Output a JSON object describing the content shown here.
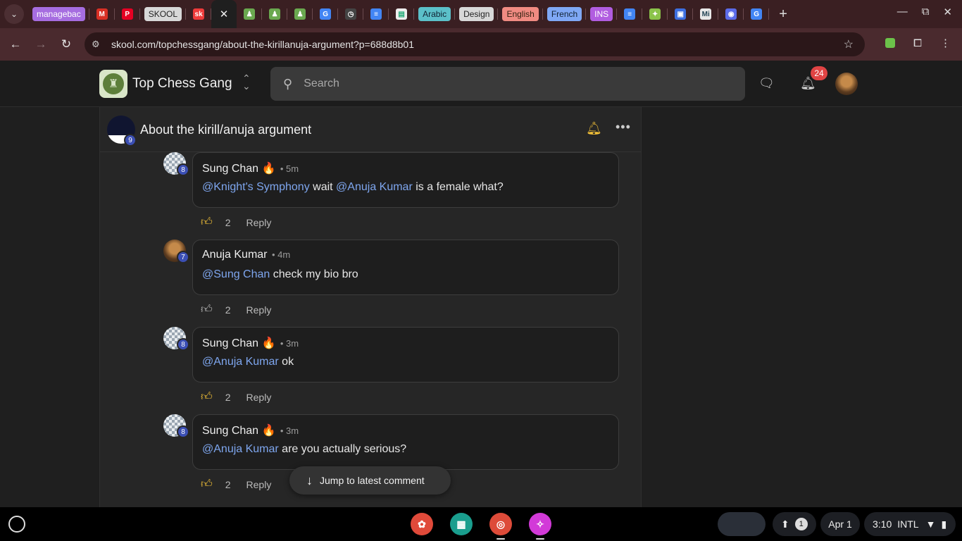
{
  "browser": {
    "tabs": [
      {
        "type": "chip",
        "label": "managebac",
        "color": "#a66de0",
        "icon": "managebac-label"
      },
      {
        "type": "icon",
        "icon": "gmail-icon",
        "glyph": "M",
        "color": "#d93025"
      },
      {
        "type": "icon",
        "icon": "pinterest-icon",
        "glyph": "P",
        "color": "#e60023"
      },
      {
        "type": "chip",
        "label": "SKOOL",
        "color": "#d8d8d8",
        "text_color": "#222",
        "icon": "skool-label"
      },
      {
        "type": "icon",
        "icon": "skool-icon",
        "glyph": "sk",
        "color": "#ef3b3b"
      },
      {
        "type": "active",
        "icon": "close-icon",
        "glyph": "✕"
      },
      {
        "type": "icon",
        "icon": "chess-pawn-icon",
        "glyph": "♟",
        "color": "#6aa84f"
      },
      {
        "type": "icon",
        "icon": "chess-pawn-icon",
        "glyph": "♟",
        "color": "#6aa84f"
      },
      {
        "type": "icon",
        "icon": "chess-pawn-icon",
        "glyph": "♟",
        "color": "#6aa84f"
      },
      {
        "type": "icon",
        "icon": "google-icon",
        "glyph": "G",
        "color": "#4285f4"
      },
      {
        "type": "icon",
        "icon": "clock-app-icon",
        "glyph": "◷",
        "color": "#444"
      },
      {
        "type": "icon",
        "icon": "google-docs-icon",
        "glyph": "≡",
        "color": "#4285f4"
      },
      {
        "type": "icon",
        "icon": "chart-page-icon",
        "glyph": "▤",
        "color": "#eee",
        "text_color": "#2a7"
      },
      {
        "type": "chip",
        "label": "Arabic",
        "color": "#5bc0c9",
        "text_color": "#123",
        "icon": "arabic-label"
      },
      {
        "type": "chip",
        "label": "Design",
        "color": "#d8d8d8",
        "text_color": "#222",
        "icon": "design-label"
      },
      {
        "type": "chip",
        "label": "English",
        "color": "#f08b82",
        "text_color": "#321",
        "icon": "english-label"
      },
      {
        "type": "chip",
        "label": "French",
        "color": "#7fa8f5",
        "text_color": "#123",
        "icon": "french-label"
      },
      {
        "type": "chip",
        "label": "INS",
        "color": "#b15de0",
        "icon": "ins-label"
      },
      {
        "type": "icon",
        "icon": "google-docs-icon",
        "glyph": "≡",
        "color": "#4285f4"
      },
      {
        "type": "icon",
        "icon": "alien-icon",
        "glyph": "✦",
        "color": "#8bc34a"
      },
      {
        "type": "icon",
        "icon": "phone-app-icon",
        "glyph": "▣",
        "color": "#3d6fe0"
      },
      {
        "type": "icon",
        "icon": "mi-icon",
        "glyph": "Mi",
        "color": "#e8e8e8",
        "text_color": "#245"
      },
      {
        "type": "icon",
        "icon": "chat-app-icon",
        "glyph": "◉",
        "color": "#5b6be8"
      },
      {
        "type": "icon",
        "icon": "google-icon",
        "glyph": "G",
        "color": "#4285f4"
      }
    ],
    "url": "skool.com/topchessgang/about-the-kirillanuja-argument?p=688d8b01"
  },
  "header": {
    "group_name": "Top Chess Gang",
    "search_placeholder": "Search",
    "notification_count": "24"
  },
  "post": {
    "title": "About the kirill/anuja argument",
    "author_level": "9"
  },
  "comments": [
    {
      "author": "Sung Chan 🔥",
      "time": "• 5m",
      "level": "8",
      "avatar": "chess",
      "segments": [
        {
          "text": "@Knight's Symphony",
          "mention": true
        },
        {
          "text": " wait ",
          "mention": false
        },
        {
          "text": "@Anuja Kumar",
          "mention": true
        },
        {
          "text": " is a female what?",
          "mention": false
        }
      ],
      "likes": "2",
      "liked": true,
      "reply_label": "Reply"
    },
    {
      "author": "Anuja Kumar",
      "time": "• 4m",
      "level": "7",
      "avatar": "mona",
      "segments": [
        {
          "text": "@Sung Chan",
          "mention": true
        },
        {
          "text": " check my bio bro",
          "mention": false
        }
      ],
      "likes": "2",
      "liked": false,
      "reply_label": "Reply"
    },
    {
      "author": "Sung Chan 🔥",
      "time": "• 3m",
      "level": "8",
      "avatar": "chess",
      "segments": [
        {
          "text": "@Anuja Kumar",
          "mention": true
        },
        {
          "text": " ok",
          "mention": false
        }
      ],
      "likes": "2",
      "liked": true,
      "reply_label": "Reply"
    },
    {
      "author": "Sung Chan 🔥",
      "time": "• 3m",
      "level": "8",
      "avatar": "chess",
      "segments": [
        {
          "text": "@Anuja Kumar",
          "mention": true
        },
        {
          "text": " are you actually serious?",
          "mention": false
        }
      ],
      "likes": "2",
      "liked": true,
      "reply_label": "Reply"
    }
  ],
  "jump_label": "Jump to latest comment",
  "shelf": {
    "apps": [
      {
        "icon": "paint-app-icon",
        "glyph": "✿",
        "color": "#e04a3a"
      },
      {
        "icon": "classroom-app-icon",
        "glyph": "▦",
        "color": "#1a9e8e"
      },
      {
        "icon": "chrome-icon",
        "glyph": "◎",
        "color": "#dd4b39",
        "active": true
      },
      {
        "icon": "gallery-app-icon",
        "glyph": "✧",
        "color": "#d23ad8",
        "active": true
      }
    ],
    "notifications_count": "1",
    "date": "Apr 1",
    "time": "3:10",
    "input_method": "INTL"
  }
}
